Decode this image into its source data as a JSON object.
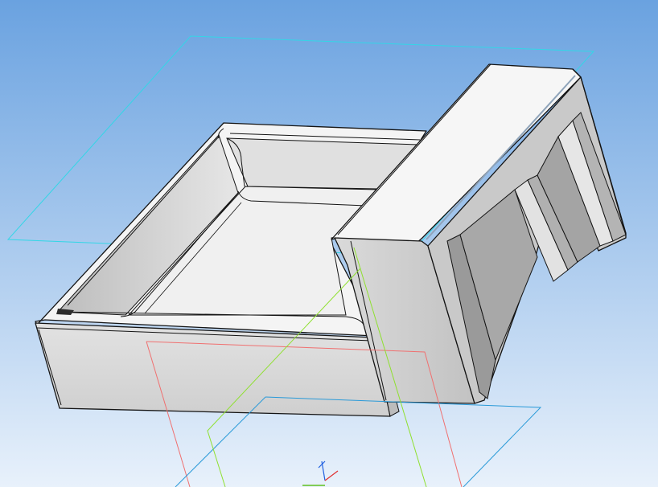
{
  "viewport": {
    "background_top_color": "#6aa2e0",
    "background_bottom_color": "#e8f1fb"
  },
  "model": {
    "face_light_color": "#f4f4f4",
    "face_mid_color": "#dcdcdc",
    "face_dark_color": "#a8a8a8",
    "edge_color": "#141414"
  },
  "reference_planes": [
    {
      "name": "top-plane",
      "color": "#33d6e6"
    },
    {
      "name": "front-plane",
      "color": "#f07070"
    },
    {
      "name": "right-plane",
      "color": "#2a9ad8"
    },
    {
      "name": "axis-line",
      "color": "#8fe030"
    }
  ],
  "triad": {
    "x_color": "#e03030",
    "y_color": "#60c020",
    "z_color": "#2060e0"
  }
}
